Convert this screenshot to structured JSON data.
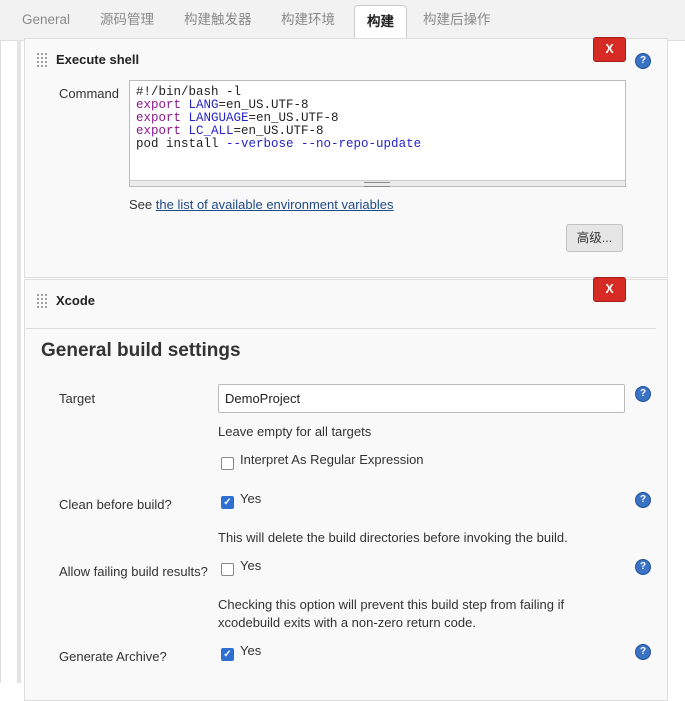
{
  "tabs": [
    "General",
    "源码管理",
    "构建触发器",
    "构建环境",
    "构建",
    "构建后操作"
  ],
  "execute_shell": {
    "title": "Execute shell",
    "delete_label": "X",
    "help_label": "?",
    "command_label": "Command",
    "see_prefix": "See",
    "env_link": "the list of available environment variables",
    "advanced_button": "高级..."
  },
  "shell_script": {
    "line1": "#!/bin/bash -l",
    "export_kw": "export",
    "lang_var": "LANG",
    "lang_val": "=en_US.UTF-8",
    "language_var": "LANGUAGE",
    "language_val": "=en_US.UTF-8",
    "lc_var": "LC_ALL",
    "lc_val": "=en_US.UTF-8",
    "pod_cmd": "pod install ",
    "flag_verbose": "--verbose",
    "flag_norepo": "--no-repo-update"
  },
  "xcode": {
    "title": "Xcode",
    "delete_label": "X",
    "heading": "General build settings",
    "target_label": "Target",
    "target_value": "DemoProject",
    "target_hint": "Leave empty for all targets",
    "regex_label": "Interpret As Regular Expression",
    "regex_checked": false,
    "clean_label": "Clean before build?",
    "clean_yes": "Yes",
    "clean_checked": true,
    "clean_desc": "This will delete the build directories before invoking the build.",
    "allow_label": "Allow failing build results?",
    "allow_yes": "Yes",
    "allow_checked": false,
    "allow_desc_1": "Checking this option will prevent this build step from failing if",
    "allow_desc_2": "xcodebuild exits with a non-zero return code.",
    "archive_label": "Generate Archive?",
    "archive_yes": "Yes",
    "archive_checked": true,
    "help_label": "?"
  },
  "colors": {
    "delete_red": "#d62a25",
    "help_blue": "#3b73c4",
    "checkbox_blue": "#2f6fd0",
    "link_blue": "#204a87"
  }
}
